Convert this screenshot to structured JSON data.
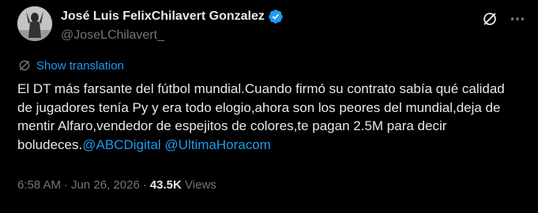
{
  "author": {
    "display_name": "José Luis FelixChilavert Gonzalez",
    "handle": "@JoseLChilavert_",
    "verified_icon": "verified-badge-icon",
    "verified_color": "#1d9bf0"
  },
  "actions": {
    "grok_icon": "grok-icon",
    "more_icon": "more-options-icon"
  },
  "translation": {
    "label": "Show translation",
    "icon": "translate-icon"
  },
  "tweet": {
    "text_main": "El DT más farsante del fútbol mundial.Cuando firmó su contrato sabía qué calidad de jugadores tenía Py y era todo elogio,ahora son los peores del mundial,deja de mentir Alfaro,vendedor de espejitos de colores,te pagan 2.5M para decir boludeces.",
    "mention_1": "@ABCDigital",
    "mention_2": "@UltimaHoracom"
  },
  "meta": {
    "time": "6:58 AM",
    "separator_1": "·",
    "date": "Jun 26, 2026",
    "separator_2": "·",
    "views_count": "43.5K",
    "views_label": "Views"
  },
  "colors": {
    "background": "#000000",
    "text": "#e7e9ea",
    "secondary": "#71767b",
    "link": "#1d9bf0"
  }
}
